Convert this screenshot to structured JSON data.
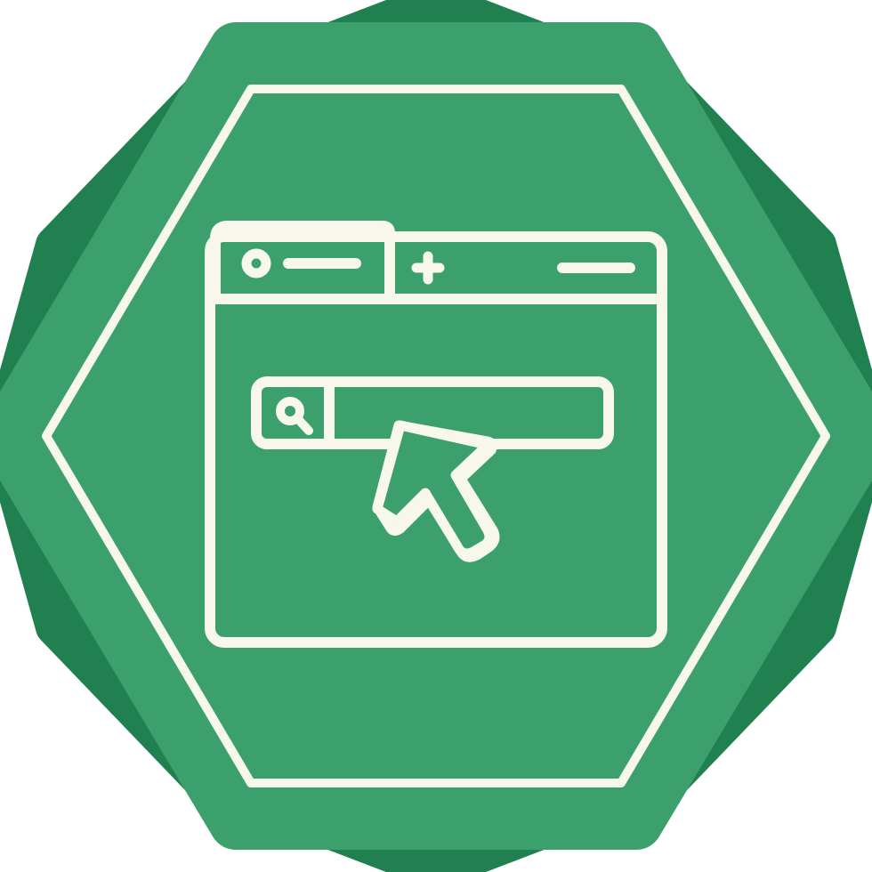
{
  "icon": {
    "name": "browser-search-click-icon",
    "description_tags": [
      "browser-window-icon",
      "search-bar-icon",
      "cursor-arrow-icon",
      "badge-icon"
    ]
  },
  "colors": {
    "background": "#ffffff",
    "badge_back": "#21804f",
    "badge_front": "#3ba06c",
    "line": "#f8f7ec"
  }
}
